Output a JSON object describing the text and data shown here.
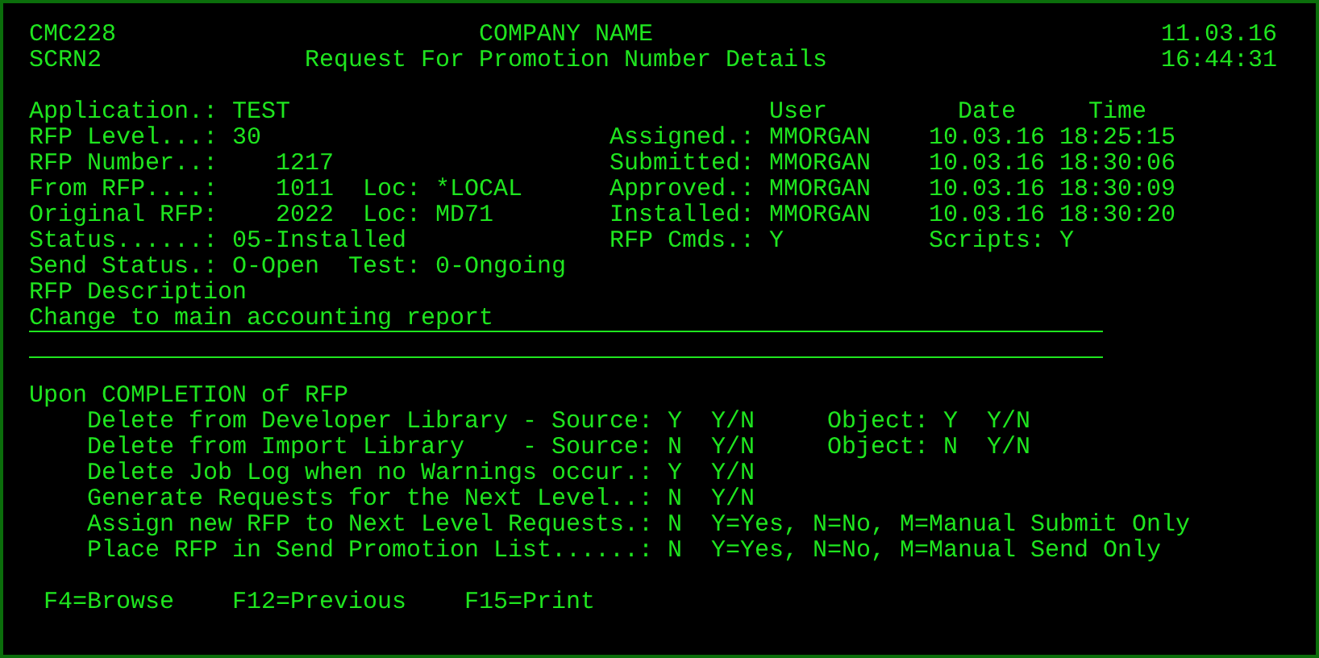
{
  "header": {
    "program": "CMC228",
    "company": "COMPANY NAME",
    "date": "11.03.16",
    "screen": "SCRN2",
    "title": "Request For Promotion Number Details",
    "time": "16:44:31"
  },
  "fields": [
    {
      "kind": "text",
      "label": "Application.:",
      "value": "TEST"
    },
    {
      "kind": "text",
      "label": "RFP Level...:",
      "value": "30"
    },
    {
      "kind": "number",
      "label": "RFP Number..:",
      "value": "1217"
    },
    {
      "kind": "number",
      "label": "From RFP....:",
      "value": "1011",
      "loc_label": "Loc:",
      "loc": "*LOCAL"
    },
    {
      "kind": "number",
      "label": "Original RFP:",
      "value": "2022",
      "loc_label": "Loc:",
      "loc": "MD71"
    },
    {
      "kind": "text",
      "label": "Status......:",
      "value": "05-Installed"
    },
    {
      "kind": "text",
      "label": "Send Status.:",
      "value": "O-Open",
      "extra_label": "Test:",
      "extra_value": "0-Ongoing"
    }
  ],
  "history": {
    "columns": [
      "User",
      "Date",
      "Time"
    ],
    "rows": [
      {
        "label": "Assigned.:",
        "user": "MMORGAN",
        "date": "10.03.16",
        "time": "18:25:15"
      },
      {
        "label": "Submitted:",
        "user": "MMORGAN",
        "date": "10.03.16",
        "time": "18:30:06"
      },
      {
        "label": "Approved.:",
        "user": "MMORGAN",
        "date": "10.03.16",
        "time": "18:30:09"
      },
      {
        "label": "Installed:",
        "user": "MMORGAN",
        "date": "10.03.16",
        "time": "18:30:20"
      }
    ],
    "flags": [
      {
        "label": "RFP Cmds.:",
        "value": "Y"
      },
      {
        "label": "Scripts:",
        "value": "Y"
      }
    ]
  },
  "description": {
    "label": "RFP Description",
    "value": "Change to main accounting report"
  },
  "completion": {
    "title": "Upon COMPLETION of RFP",
    "options": [
      {
        "kind": "source_object",
        "label": "Delete from Developer Library - Source:",
        "value": "Y",
        "hint": "Y/N",
        "object_label": "Object:",
        "object_value": "Y",
        "object_hint": "Y/N"
      },
      {
        "kind": "source_object",
        "label": "Delete from Import Library    - Source:",
        "value": "N",
        "hint": "Y/N",
        "object_label": "Object:",
        "object_value": "N",
        "object_hint": "Y/N"
      },
      {
        "kind": "single",
        "label": "Delete Job Log when no Warnings occur.:",
        "value": "Y",
        "hint": "Y/N"
      },
      {
        "kind": "single",
        "label": "Generate Requests for the Next Level..:",
        "value": "N",
        "hint": "Y/N"
      },
      {
        "kind": "single",
        "label": "Assign new RFP to Next Level Requests.:",
        "value": "N",
        "hint": "Y=Yes, N=No, M=Manual Submit Only"
      },
      {
        "kind": "single",
        "label": "Place RFP in Send Promotion List......:",
        "value": "N",
        "hint": "Y=Yes, N=No, M=Manual Send Only"
      }
    ]
  },
  "function_keys": [
    "F4=Browse",
    "F12=Previous",
    "F15=Print"
  ]
}
